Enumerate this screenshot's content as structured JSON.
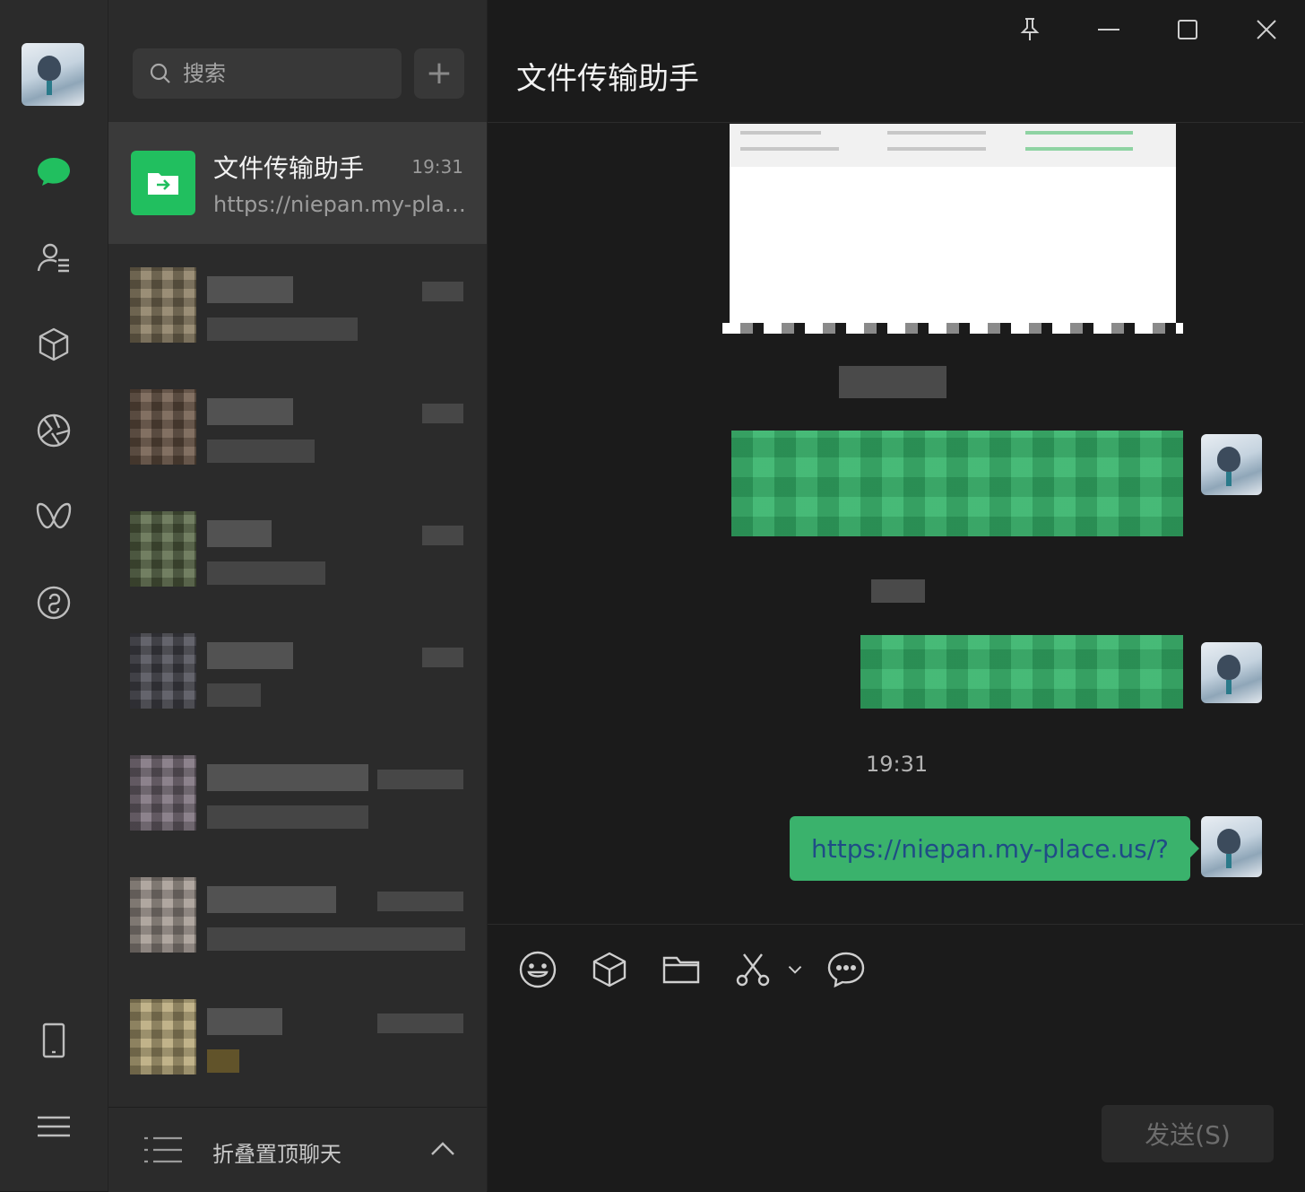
{
  "rail": {
    "icons": [
      "chat-icon",
      "contacts-icon",
      "favorites-cube-icon",
      "moments-aperture-icon",
      "channels-butterfly-icon",
      "mini-programs-icon",
      "phone-icon",
      "menu-icon"
    ]
  },
  "search": {
    "placeholder": "搜索",
    "add_label": "+"
  },
  "chat_list": {
    "active": {
      "name": "文件传输助手",
      "time": "19:31",
      "preview": "https://niepan.my-place.us/?"
    }
  },
  "collapse_bar": {
    "label": "折叠置顶聊天"
  },
  "chat": {
    "title": "文件传输助手",
    "timestamp": "19:31",
    "link_message": "https://niepan.my-place.us/?"
  },
  "toolbar": {
    "icons": [
      "emoji-icon",
      "favorites-cube-icon",
      "folder-icon",
      "screenshot-scissors-icon",
      "chevron-down-icon",
      "chat-history-icon"
    ]
  },
  "send": {
    "label": "发送(S)"
  },
  "colors": {
    "accent": "#21bf5f",
    "bubble": "#3ab26c",
    "link": "#1f4c86",
    "sidebar_bg": "#2b2b2b",
    "chat_bg": "#1b1b1b"
  }
}
